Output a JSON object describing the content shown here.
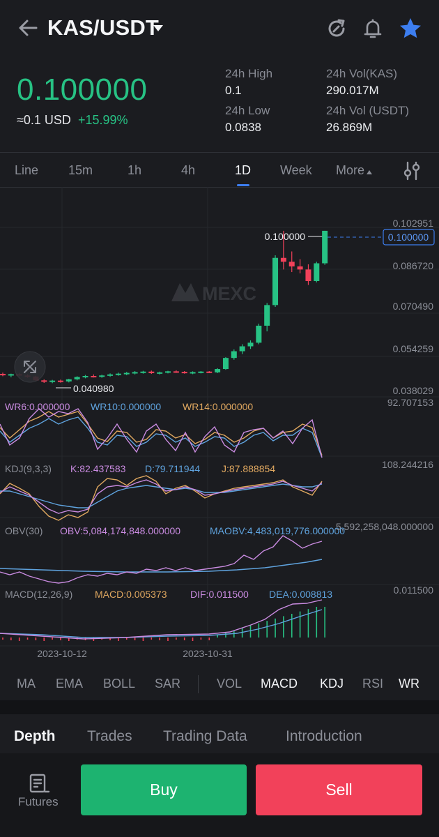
{
  "header": {
    "pair": "KAS/USDT",
    "icons": [
      "back-arrow-icon",
      "refresh-icon",
      "bell-icon",
      "star-icon"
    ],
    "star_color": "#3d7ef0"
  },
  "ticker": {
    "price": "0.100000",
    "usd_value": "≈0.1 USD",
    "change": "+15.99%",
    "high_label": "24h High",
    "high_value": "0.1",
    "low_label": "24h Low",
    "low_value": "0.0838",
    "vol_kas_label": "24h Vol(KAS)",
    "vol_kas_value": "290.017M",
    "vol_usdt_label": "24h Vol (USDT)",
    "vol_usdt_value": "26.869M",
    "up_color": "#27c284",
    "down_color": "#f2415a"
  },
  "tabs": {
    "items": [
      "Line",
      "15m",
      "1h",
      "4h",
      "1D",
      "Week",
      "More"
    ],
    "active": "1D",
    "settings_icon": "sliders-icon"
  },
  "chart": {
    "watermark": "MEXC",
    "price_axis": [
      "0.102951",
      "0.086720",
      "0.070490",
      "0.054259",
      "0.038029"
    ],
    "last_price_tag": "0.100000",
    "high_marker": "0.100000",
    "low_marker": "0.040980",
    "date_labels": [
      "2023-10-12",
      "2023-10-31"
    ],
    "wr": {
      "wr6": "WR6:0.000000",
      "wr10": "WR10:0.000000",
      "wr14": "WR14:0.000000",
      "axis": "92.707153"
    },
    "kdj": {
      "name": "KDJ(9,3,3)",
      "k": "K:82.437583",
      "d": "D:79.711944",
      "j": "J:87.888854",
      "axis": "108.244216"
    },
    "obv": {
      "name": "OBV(30)",
      "obv": "OBV:5,084,174,848.000000",
      "maobv": "MAOBV:4,483,019,776.000000",
      "axis": "5,592,258,048.000000"
    },
    "macd": {
      "name": "MACD(12,26,9)",
      "macd": "MACD:0.005373",
      "dif": "DIF:0.011500",
      "dea": "DEA:0.008813",
      "axis": "0.011500"
    },
    "colors": {
      "purple": "#c98be0",
      "blue": "#5fa3de",
      "orange": "#e0a860",
      "label_gray": "#8b8e97"
    }
  },
  "chart_data": {
    "type": "candlestick",
    "ylim": [
      0.038029,
      0.102951
    ],
    "price_ticks": [
      0.102951,
      0.08672,
      0.07049,
      0.054259,
      0.038029
    ],
    "ohlc": [
      [
        0.0445,
        0.045,
        0.0436,
        0.044
      ],
      [
        0.044,
        0.0446,
        0.0432,
        0.0444
      ],
      [
        0.0444,
        0.0449,
        0.0436,
        0.0439
      ],
      [
        0.0439,
        0.0444,
        0.043,
        0.0435
      ],
      [
        0.0435,
        0.0438,
        0.0418,
        0.042
      ],
      [
        0.042,
        0.0424,
        0.041,
        0.0415
      ],
      [
        0.0415,
        0.0422,
        0.0409,
        0.0419
      ],
      [
        0.0419,
        0.0423,
        0.0411,
        0.0416
      ],
      [
        0.0416,
        0.0426,
        0.0412,
        0.0424
      ],
      [
        0.0424,
        0.0436,
        0.042,
        0.0433
      ],
      [
        0.0433,
        0.0441,
        0.0428,
        0.0437
      ],
      [
        0.0437,
        0.0443,
        0.0431,
        0.0434
      ],
      [
        0.0434,
        0.0442,
        0.043,
        0.0439
      ],
      [
        0.0439,
        0.0447,
        0.0434,
        0.0443
      ],
      [
        0.0443,
        0.045,
        0.0438,
        0.0446
      ],
      [
        0.0446,
        0.0453,
        0.044,
        0.0449
      ],
      [
        0.0449,
        0.0456,
        0.0443,
        0.0452
      ],
      [
        0.0452,
        0.0457,
        0.0446,
        0.0454
      ],
      [
        0.0454,
        0.0458,
        0.0445,
        0.0448
      ],
      [
        0.0448,
        0.0454,
        0.0443,
        0.0451
      ],
      [
        0.0451,
        0.0457,
        0.0447,
        0.0455
      ],
      [
        0.0455,
        0.0459,
        0.0449,
        0.0453
      ],
      [
        0.0453,
        0.0456,
        0.0446,
        0.0449
      ],
      [
        0.0449,
        0.0455,
        0.0444,
        0.0452
      ],
      [
        0.0452,
        0.0456,
        0.0447,
        0.0454
      ],
      [
        0.0454,
        0.0456,
        0.0448,
        0.0451
      ],
      [
        0.0451,
        0.0467,
        0.0448,
        0.0464
      ],
      [
        0.0464,
        0.051,
        0.0461,
        0.0507
      ],
      [
        0.0507,
        0.054,
        0.05,
        0.0533
      ],
      [
        0.0533,
        0.056,
        0.0522,
        0.0552
      ],
      [
        0.0552,
        0.0575,
        0.0542,
        0.0566
      ],
      [
        0.0566,
        0.064,
        0.056,
        0.0632
      ],
      [
        0.0632,
        0.072,
        0.061,
        0.0712
      ],
      [
        0.0712,
        0.0905,
        0.0705,
        0.0895
      ],
      [
        0.0895,
        0.1,
        0.085,
        0.088
      ],
      [
        0.088,
        0.092,
        0.084,
        0.0862
      ],
      [
        0.0862,
        0.089,
        0.0835,
        0.085
      ],
      [
        0.085,
        0.087,
        0.079,
        0.0805
      ],
      [
        0.0805,
        0.088,
        0.08,
        0.0874
      ],
      [
        0.0874,
        0.1,
        0.0868,
        0.1
      ]
    ],
    "dates": [
      "2023-10-12",
      "2023-10-31"
    ]
  },
  "indicator_bar": {
    "items": [
      "MA",
      "EMA",
      "BOLL",
      "SAR",
      "VOL",
      "MACD",
      "KDJ",
      "RSI",
      "WR"
    ],
    "active": [
      "MACD",
      "KDJ",
      "WR"
    ]
  },
  "lower_tabs": {
    "items": [
      "Depth",
      "Trades",
      "Trading Data",
      "Introduction"
    ],
    "active": "Depth"
  },
  "bottom": {
    "futures_label": "Futures",
    "buy_label": "Buy",
    "sell_label": "Sell",
    "buy_color": "#1db370",
    "sell_color": "#f2415a"
  }
}
